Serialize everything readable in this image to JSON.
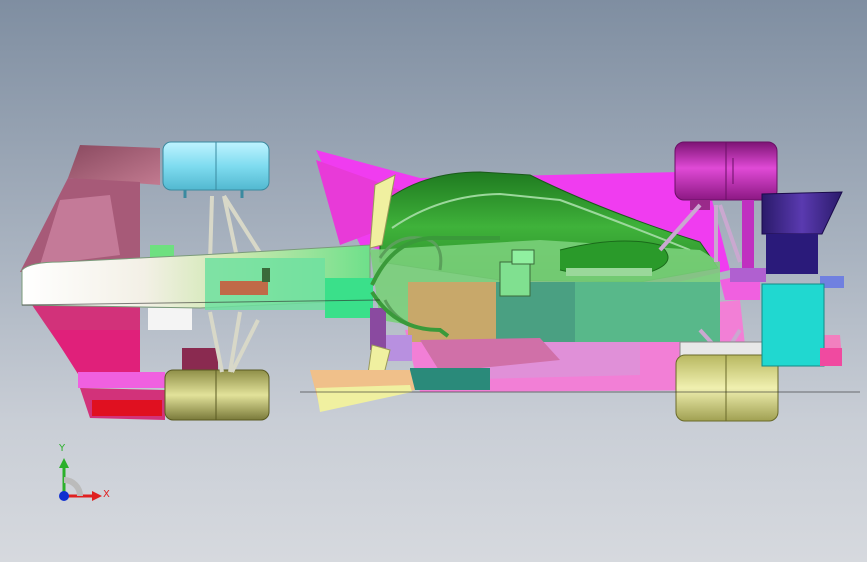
{
  "viewer": {
    "model": "car-underside-view",
    "background": {
      "top": "#7f8ea1",
      "bottom": "#d6d9de"
    }
  },
  "triad": {
    "y_label": "Y",
    "x_label": "X",
    "colors": {
      "x": "#e02020",
      "y": "#2bb02b",
      "z": "#1030d0"
    }
  },
  "parts": [
    {
      "name": "front-wing",
      "color": "#d23a86"
    },
    {
      "name": "front-wheels",
      "color": "#c9c97a"
    },
    {
      "name": "rear-wheels",
      "color": "#c21fb5"
    },
    {
      "name": "chassis",
      "color": "#2e9a36"
    },
    {
      "name": "floor",
      "color": "#f03cf0"
    },
    {
      "name": "rear-wing",
      "color": "#20d8d0"
    }
  ]
}
